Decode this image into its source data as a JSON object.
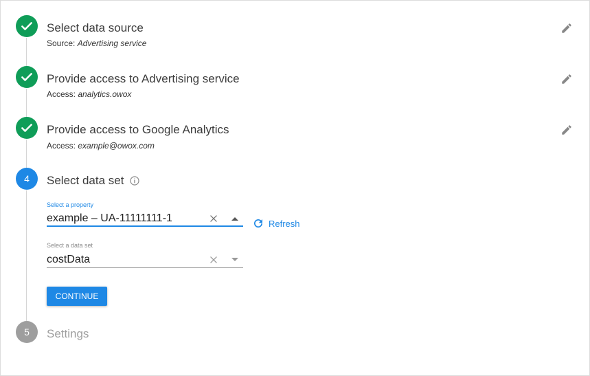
{
  "steps": [
    {
      "number": "1",
      "state": "done",
      "title": "Select data source",
      "sub_label": "Source:",
      "sub_value": "Advertising service"
    },
    {
      "number": "2",
      "state": "done",
      "title": "Provide access to Advertising service",
      "sub_label": "Access:",
      "sub_value": "analytics.owox"
    },
    {
      "number": "3",
      "state": "done",
      "title": "Provide access to Google Analytics",
      "sub_label": "Access:",
      "sub_value": "example@owox.com"
    },
    {
      "number": "4",
      "state": "active",
      "title": "Select data set"
    },
    {
      "number": "5",
      "state": "pending",
      "title": "Settings"
    }
  ],
  "form": {
    "property": {
      "label": "Select a property",
      "value": "example – UA-11111111-1"
    },
    "dataset": {
      "label": "Select a data set",
      "value": "costData"
    },
    "refresh_label": "Refresh",
    "continue_label": "CONTINUE"
  },
  "colors": {
    "done": "#0f9d58",
    "active": "#1e88e5",
    "pending": "#9e9e9e",
    "accent": "#1e88e5"
  },
  "icons": {
    "done": "check-icon",
    "edit": "pencil-icon",
    "info": "info-icon",
    "clear": "close-icon",
    "dropdown_open": "arrow-up-icon",
    "dropdown_closed": "arrow-down-icon",
    "refresh": "refresh-icon"
  }
}
